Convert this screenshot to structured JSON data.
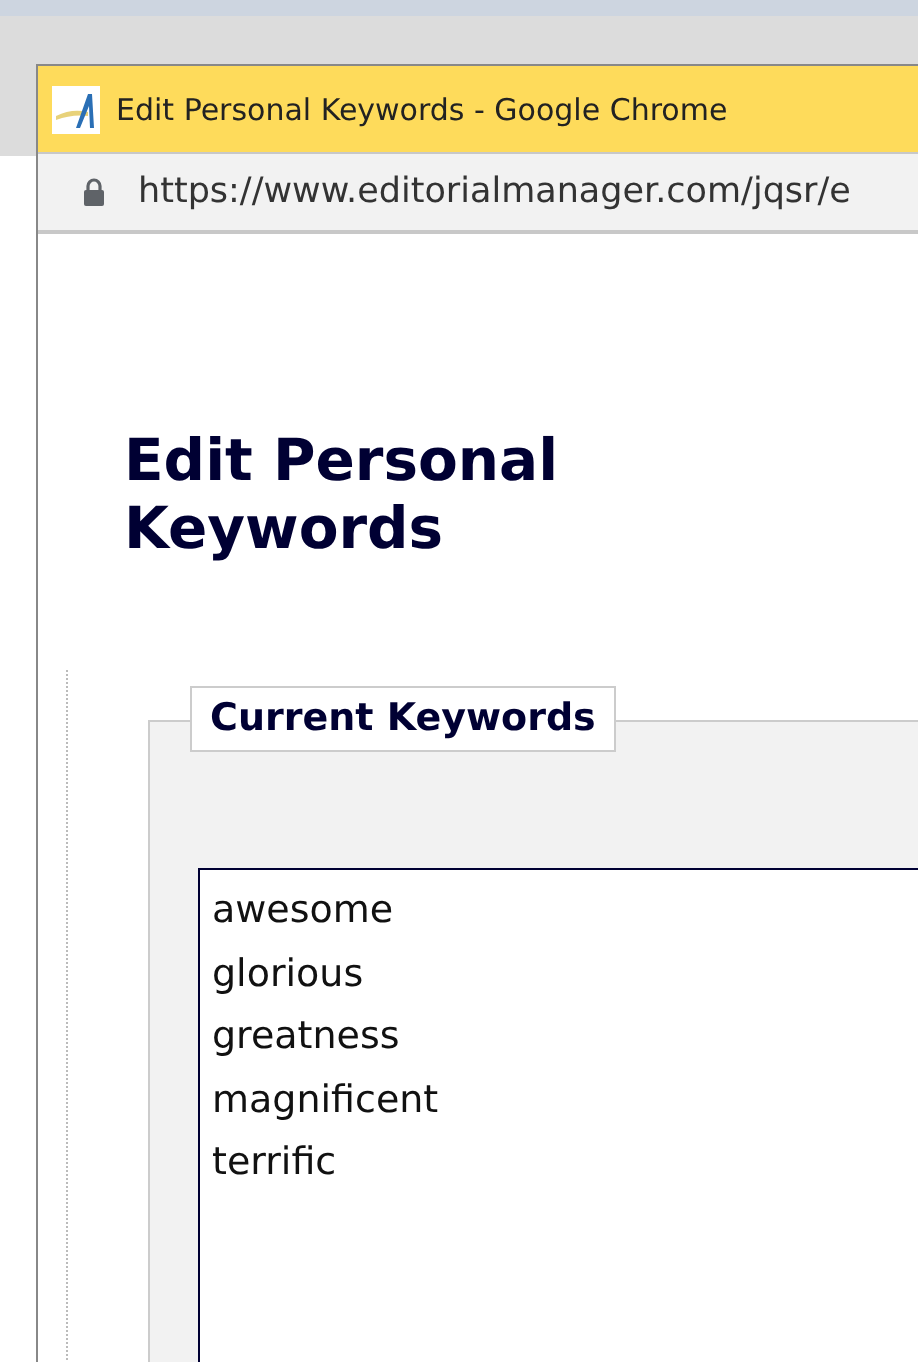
{
  "window": {
    "title": "Edit Personal Keywords - Google Chrome"
  },
  "address_bar": {
    "url": "https://www.editorialmanager.com/jqsr/e"
  },
  "page": {
    "heading": "Edit Personal Keywords",
    "fieldset": {
      "legend": "Current Keywords",
      "keywords": [
        "awesome",
        "glorious",
        "greatness",
        "magnificent",
        "terrific"
      ]
    }
  }
}
